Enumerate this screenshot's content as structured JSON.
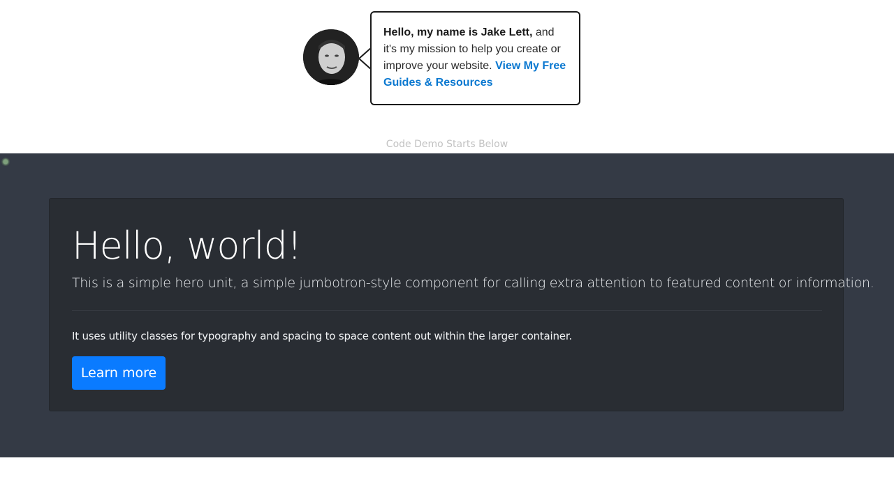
{
  "author_box": {
    "intro_bold": "Hello, my name is Jake Lett,",
    "intro_rest": " and it's my mission to help you create or improve your website. ",
    "link_label": "View My Free Guides & Resources"
  },
  "demo_note": "Code Demo Starts Below",
  "jumbotron": {
    "title": "Hello, world!",
    "lead": "This is a simple hero unit, a simple jumbotron-style component for calling extra attention to featured content or information.",
    "text": "It uses utility classes for typography and spacing to space content out within the larger container.",
    "button_label": "Learn more"
  },
  "colors": {
    "link": "#0a78d0",
    "demo_background": "#343a45",
    "jumbotron_background": "#292d33",
    "button": "#0a7bff"
  }
}
